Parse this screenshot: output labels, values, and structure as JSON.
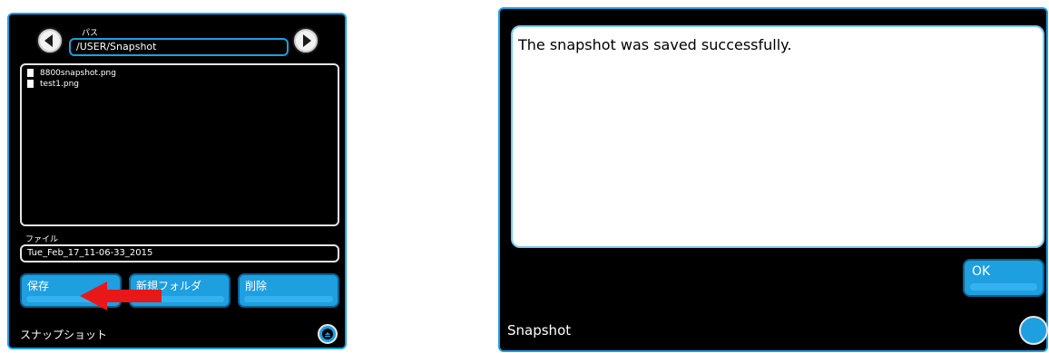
{
  "left_screen": {
    "path_label": "パス",
    "path_value": "/USER/Snapshot",
    "files": [
      "8800snapshot.png",
      "test1.png"
    ],
    "file_label": "ファイル",
    "file_value": "Tue_Feb_17_11-06-33_2015",
    "buttons": {
      "save": "保存",
      "new_folder": "新規フォルダ",
      "delete": "削除"
    },
    "screen_title": "スナップショット",
    "annotation_arrow_color": "#e81818"
  },
  "right_screen": {
    "message": "The snapshot was saved successfully.",
    "ok_label": "OK",
    "screen_title": "Snapshot"
  },
  "colors": {
    "accent": "#1aa0e6",
    "button_fill": "#1e9fe0",
    "background": "#000000"
  }
}
